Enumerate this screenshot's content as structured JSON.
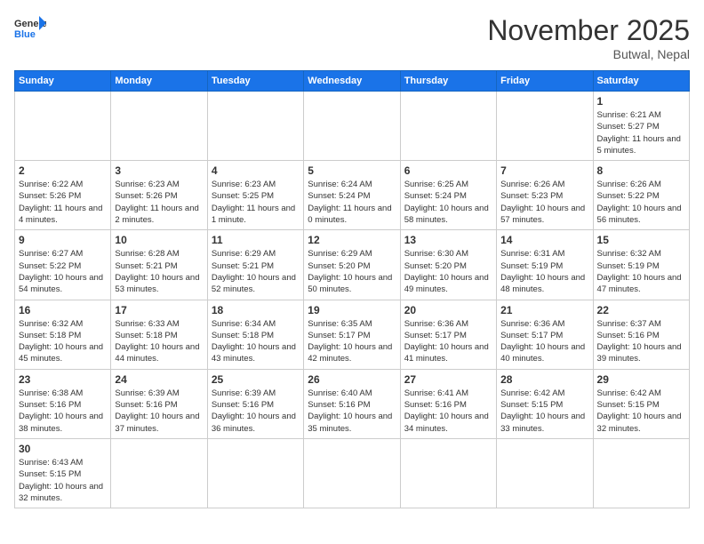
{
  "header": {
    "logo_general": "General",
    "logo_blue": "Blue",
    "month_title": "November 2025",
    "subtitle": "Butwal, Nepal"
  },
  "days_of_week": [
    "Sunday",
    "Monday",
    "Tuesday",
    "Wednesday",
    "Thursday",
    "Friday",
    "Saturday"
  ],
  "weeks": [
    [
      {
        "day": "",
        "info": ""
      },
      {
        "day": "",
        "info": ""
      },
      {
        "day": "",
        "info": ""
      },
      {
        "day": "",
        "info": ""
      },
      {
        "day": "",
        "info": ""
      },
      {
        "day": "",
        "info": ""
      },
      {
        "day": "1",
        "info": "Sunrise: 6:21 AM\nSunset: 5:27 PM\nDaylight: 11 hours and 5 minutes."
      }
    ],
    [
      {
        "day": "2",
        "info": "Sunrise: 6:22 AM\nSunset: 5:26 PM\nDaylight: 11 hours and 4 minutes."
      },
      {
        "day": "3",
        "info": "Sunrise: 6:23 AM\nSunset: 5:26 PM\nDaylight: 11 hours and 2 minutes."
      },
      {
        "day": "4",
        "info": "Sunrise: 6:23 AM\nSunset: 5:25 PM\nDaylight: 11 hours and 1 minute."
      },
      {
        "day": "5",
        "info": "Sunrise: 6:24 AM\nSunset: 5:24 PM\nDaylight: 11 hours and 0 minutes."
      },
      {
        "day": "6",
        "info": "Sunrise: 6:25 AM\nSunset: 5:24 PM\nDaylight: 10 hours and 58 minutes."
      },
      {
        "day": "7",
        "info": "Sunrise: 6:26 AM\nSunset: 5:23 PM\nDaylight: 10 hours and 57 minutes."
      },
      {
        "day": "8",
        "info": "Sunrise: 6:26 AM\nSunset: 5:22 PM\nDaylight: 10 hours and 56 minutes."
      }
    ],
    [
      {
        "day": "9",
        "info": "Sunrise: 6:27 AM\nSunset: 5:22 PM\nDaylight: 10 hours and 54 minutes."
      },
      {
        "day": "10",
        "info": "Sunrise: 6:28 AM\nSunset: 5:21 PM\nDaylight: 10 hours and 53 minutes."
      },
      {
        "day": "11",
        "info": "Sunrise: 6:29 AM\nSunset: 5:21 PM\nDaylight: 10 hours and 52 minutes."
      },
      {
        "day": "12",
        "info": "Sunrise: 6:29 AM\nSunset: 5:20 PM\nDaylight: 10 hours and 50 minutes."
      },
      {
        "day": "13",
        "info": "Sunrise: 6:30 AM\nSunset: 5:20 PM\nDaylight: 10 hours and 49 minutes."
      },
      {
        "day": "14",
        "info": "Sunrise: 6:31 AM\nSunset: 5:19 PM\nDaylight: 10 hours and 48 minutes."
      },
      {
        "day": "15",
        "info": "Sunrise: 6:32 AM\nSunset: 5:19 PM\nDaylight: 10 hours and 47 minutes."
      }
    ],
    [
      {
        "day": "16",
        "info": "Sunrise: 6:32 AM\nSunset: 5:18 PM\nDaylight: 10 hours and 45 minutes."
      },
      {
        "day": "17",
        "info": "Sunrise: 6:33 AM\nSunset: 5:18 PM\nDaylight: 10 hours and 44 minutes."
      },
      {
        "day": "18",
        "info": "Sunrise: 6:34 AM\nSunset: 5:18 PM\nDaylight: 10 hours and 43 minutes."
      },
      {
        "day": "19",
        "info": "Sunrise: 6:35 AM\nSunset: 5:17 PM\nDaylight: 10 hours and 42 minutes."
      },
      {
        "day": "20",
        "info": "Sunrise: 6:36 AM\nSunset: 5:17 PM\nDaylight: 10 hours and 41 minutes."
      },
      {
        "day": "21",
        "info": "Sunrise: 6:36 AM\nSunset: 5:17 PM\nDaylight: 10 hours and 40 minutes."
      },
      {
        "day": "22",
        "info": "Sunrise: 6:37 AM\nSunset: 5:16 PM\nDaylight: 10 hours and 39 minutes."
      }
    ],
    [
      {
        "day": "23",
        "info": "Sunrise: 6:38 AM\nSunset: 5:16 PM\nDaylight: 10 hours and 38 minutes."
      },
      {
        "day": "24",
        "info": "Sunrise: 6:39 AM\nSunset: 5:16 PM\nDaylight: 10 hours and 37 minutes."
      },
      {
        "day": "25",
        "info": "Sunrise: 6:39 AM\nSunset: 5:16 PM\nDaylight: 10 hours and 36 minutes."
      },
      {
        "day": "26",
        "info": "Sunrise: 6:40 AM\nSunset: 5:16 PM\nDaylight: 10 hours and 35 minutes."
      },
      {
        "day": "27",
        "info": "Sunrise: 6:41 AM\nSunset: 5:16 PM\nDaylight: 10 hours and 34 minutes."
      },
      {
        "day": "28",
        "info": "Sunrise: 6:42 AM\nSunset: 5:15 PM\nDaylight: 10 hours and 33 minutes."
      },
      {
        "day": "29",
        "info": "Sunrise: 6:42 AM\nSunset: 5:15 PM\nDaylight: 10 hours and 32 minutes."
      }
    ],
    [
      {
        "day": "30",
        "info": "Sunrise: 6:43 AM\nSunset: 5:15 PM\nDaylight: 10 hours and 32 minutes."
      },
      {
        "day": "",
        "info": ""
      },
      {
        "day": "",
        "info": ""
      },
      {
        "day": "",
        "info": ""
      },
      {
        "day": "",
        "info": ""
      },
      {
        "day": "",
        "info": ""
      },
      {
        "day": "",
        "info": ""
      }
    ]
  ]
}
